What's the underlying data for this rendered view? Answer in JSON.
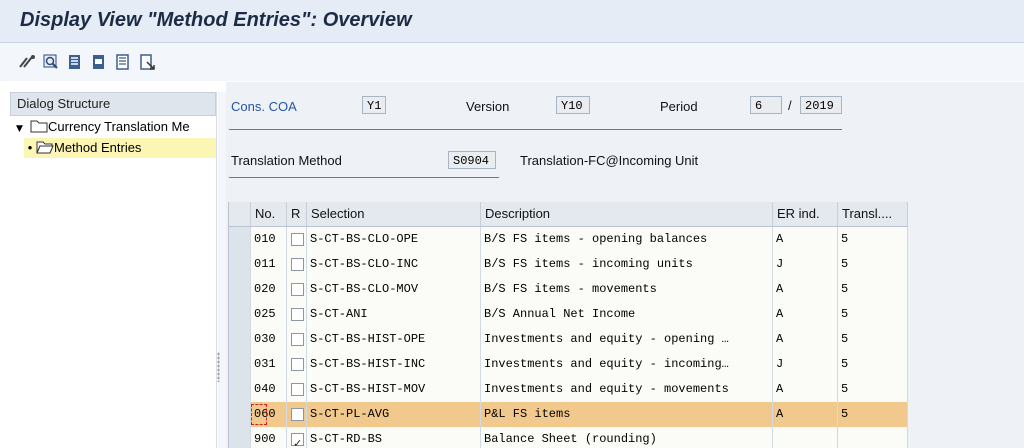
{
  "window": {
    "title": "Display View \"Method Entries\": Overview"
  },
  "toolbar": {
    "icons": [
      "glasses-icon",
      "find-icon",
      "select-all-icon",
      "select-block-icon",
      "deselect-all-icon",
      "export-icon"
    ]
  },
  "dialog_structure": {
    "header": "Dialog Structure",
    "items": [
      {
        "label": "Currency Translation Me",
        "level": 0,
        "expanded": true
      },
      {
        "label": "Method Entries",
        "level": 1,
        "selected": true
      }
    ]
  },
  "header_fields": {
    "cons_coa": {
      "label": "Cons. COA",
      "value": "Y1"
    },
    "version": {
      "label": "Version",
      "value": "Y10"
    },
    "period": {
      "label": "Period",
      "value": "6",
      "separator": "/",
      "year": "2019"
    },
    "translation_method": {
      "label": "Translation Method",
      "value": "S0904",
      "description": "Translation-FC@Incoming Unit"
    }
  },
  "table": {
    "columns": [
      "No.",
      "R",
      "Selection",
      "Description",
      "ER ind.",
      "Transl...."
    ],
    "rows": [
      {
        "no": "010",
        "r": false,
        "selection": "S-CT-BS-CLO-OPE",
        "description": "B/S FS items - opening balances",
        "er": "A",
        "transl": "5"
      },
      {
        "no": "011",
        "r": false,
        "selection": "S-CT-BS-CLO-INC",
        "description": "B/S FS items - incoming units",
        "er": "J",
        "transl": "5"
      },
      {
        "no": "020",
        "r": false,
        "selection": "S-CT-BS-CLO-MOV",
        "description": "B/S FS items - movements",
        "er": "A",
        "transl": "5"
      },
      {
        "no": "025",
        "r": false,
        "selection": "S-CT-ANI",
        "description": "B/S Annual Net Income",
        "er": "A",
        "transl": "5"
      },
      {
        "no": "030",
        "r": false,
        "selection": "S-CT-BS-HIST-OPE",
        "description": "Investments and equity - opening …",
        "er": "A",
        "transl": "5"
      },
      {
        "no": "031",
        "r": false,
        "selection": "S-CT-BS-HIST-INC",
        "description": "Investments and equity - incoming…",
        "er": "J",
        "transl": "5"
      },
      {
        "no": "040",
        "r": false,
        "selection": "S-CT-BS-HIST-MOV",
        "description": "Investments and equity - movements",
        "er": "A",
        "transl": "5"
      },
      {
        "no": "060",
        "r": false,
        "selection": "S-CT-PL-AVG",
        "description": "P&L FS items",
        "er": "A",
        "transl": "5",
        "selected": true
      },
      {
        "no": "900",
        "r": true,
        "selection": "S-CT-RD-BS",
        "description": "Balance Sheet (rounding)",
        "er": "",
        "transl": ""
      }
    ]
  },
  "colors": {
    "selected_row": "#f2c98c",
    "title_bg": "#e5ecf5",
    "tree_selected": "#fcf6b4",
    "label_blue": "#2454a4"
  }
}
